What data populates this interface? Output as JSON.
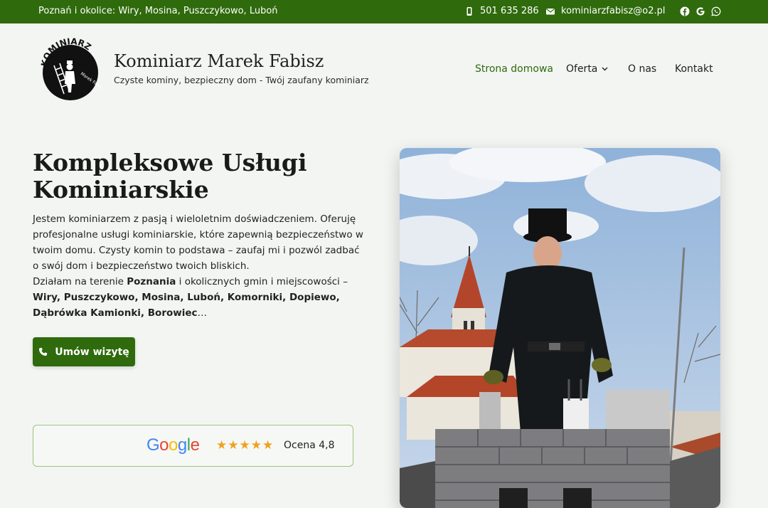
{
  "topbar": {
    "location": "Poznań i okolice: Wiry, Mosina, Puszczykowo, Luboń",
    "phone": "501 635 286",
    "email": "kominiarzfabisz@o2.pl"
  },
  "brand": {
    "logo_text": "KOMINIARZ",
    "logo_small": "Marek Fabisz",
    "title": "Kominiarz Marek Fabisz",
    "subtitle": "Czyste kominy, bezpieczny dom - Twój zaufany kominiarz"
  },
  "nav": {
    "home": "Strona domowa",
    "offer": "Oferta",
    "about": "O nas",
    "contact": "Kontakt"
  },
  "hero": {
    "title": "Kompleksowe Usługi Kominiarskie",
    "paragraph": "Jestem kominiarzem z pasją i wieloletnim doświadczeniem. Oferuję profesjonalne usługi kominiarskie, które zapewnią bezpieczeństwo w twoim domu. Czysty komin to podstawa – zaufaj mi i pozwól zadbać o swój dom i bezpieczeństwo twoich bliskich.",
    "area_prefix": "Działam na terenie ",
    "area_city": "Poznania",
    "area_mid": " i okolicznych gmin i miejscowości – ",
    "area_places": "Wiry, Puszczykowo, Mosina, Luboń, Komorniki, Dopiewo, Dąbrówka Kamionki, Borowiec",
    "area_suffix": "…",
    "cta": "Umów wizytę"
  },
  "rating": {
    "brand": "Google",
    "stars": 5,
    "label": "Ocena 4,8"
  },
  "colors": {
    "brand_green": "#2f6a0c",
    "star": "#f0a11e"
  }
}
